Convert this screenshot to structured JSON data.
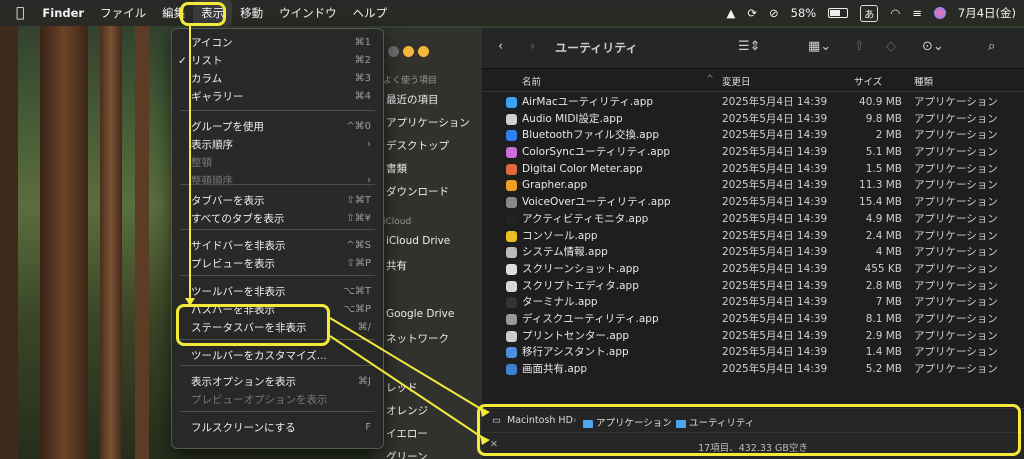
{
  "menubar": {
    "app": "Finder",
    "items": [
      "ファイル",
      "編集",
      "表示",
      "移動",
      "ウインドウ",
      "ヘルプ"
    ],
    "battery": "58%",
    "ime": "あ",
    "date": "7月4日(金)"
  },
  "view_menu": {
    "items": [
      {
        "label": "アイコン",
        "shortcut": "⌘1"
      },
      {
        "label": "リスト",
        "shortcut": "⌘2",
        "checked": "✓"
      },
      {
        "label": "カラム",
        "shortcut": "⌘3"
      },
      {
        "label": "ギャラリー",
        "shortcut": "⌘4"
      },
      {
        "label": "グループを使用",
        "shortcut": "^⌘0"
      },
      {
        "label": "表示順序",
        "shortcut": "›"
      },
      {
        "label": "整頓",
        "shortcut": ""
      },
      {
        "label": "整頓順序",
        "shortcut": "›"
      },
      {
        "label": "タブバーを表示",
        "shortcut": "⇧⌘T"
      },
      {
        "label": "すべてのタブを表示",
        "shortcut": "⇧⌘¥"
      },
      {
        "label": "サイドバーを非表示",
        "shortcut": "^⌘S"
      },
      {
        "label": "プレビューを表示",
        "shortcut": "⇧⌘P"
      },
      {
        "label": "ツールバーを非表示",
        "shortcut": "⌥⌘T"
      },
      {
        "label": "パスバーを非表示",
        "shortcut": "⌥⌘P"
      },
      {
        "label": "ステータスバーを非表示",
        "shortcut": "⌘/"
      },
      {
        "label": "ツールバーをカスタマイズ...",
        "shortcut": ""
      },
      {
        "label": "表示オプションを表示",
        "shortcut": "⌘J"
      },
      {
        "label": "プレビューオプションを表示",
        "shortcut": ""
      },
      {
        "label": "フルスクリーンにする",
        "shortcut": "F"
      }
    ]
  },
  "sidebar": {
    "heads": [
      "よく使う項目",
      "iCloud"
    ],
    "items": [
      "最近の項目",
      "アプリケーション",
      "デスクトップ",
      "書類",
      "ダウンロード",
      "iCloud Drive",
      "共有",
      "Google Drive",
      "ネットワーク",
      "レッド",
      "オレンジ",
      "イエロー",
      "グリーン"
    ]
  },
  "window": {
    "title": "ユーティリティ",
    "columns": {
      "name": "名前",
      "date": "変更日",
      "size": "サイズ",
      "kind": "種類"
    },
    "files": [
      {
        "name": "AirMacユーティリティ.app",
        "date": "2025年5月4日 14:39",
        "size": "40.9 MB",
        "kind": "アプリケーション",
        "color": "#3aa3f5"
      },
      {
        "name": "Audio MIDI設定.app",
        "date": "2025年5月4日 14:39",
        "size": "9.8 MB",
        "kind": "アプリケーション",
        "color": "#cfcfcf"
      },
      {
        "name": "Bluetoothファイル交換.app",
        "date": "2025年5月4日 14:39",
        "size": "2 MB",
        "kind": "アプリケーション",
        "color": "#2f7ff0"
      },
      {
        "name": "ColorSyncユーティリティ.app",
        "date": "2025年5月4日 14:39",
        "size": "5.1 MB",
        "kind": "アプリケーション",
        "color": "#c86fd8"
      },
      {
        "name": "Digital Color Meter.app",
        "date": "2025年5月4日 14:39",
        "size": "1.5 MB",
        "kind": "アプリケーション",
        "color": "#e06a3a"
      },
      {
        "name": "Grapher.app",
        "date": "2025年5月4日 14:39",
        "size": "11.3 MB",
        "kind": "アプリケーション",
        "color": "#f0a020"
      },
      {
        "name": "VoiceOverユーティリティ.app",
        "date": "2025年5月4日 14:39",
        "size": "15.4 MB",
        "kind": "アプリケーション",
        "color": "#888888"
      },
      {
        "name": "アクティビティモニタ.app",
        "date": "2025年5月4日 14:39",
        "size": "4.9 MB",
        "kind": "アプリケーション",
        "color": "#222222"
      },
      {
        "name": "コンソール.app",
        "date": "2025年5月4日 14:39",
        "size": "2.4 MB",
        "kind": "アプリケーション",
        "color": "#e8c020"
      },
      {
        "name": "システム情報.app",
        "date": "2025年5月4日 14:39",
        "size": "4 MB",
        "kind": "アプリケーション",
        "color": "#bbbbbb"
      },
      {
        "name": "スクリーンショット.app",
        "date": "2025年5月4日 14:39",
        "size": "455 KB",
        "kind": "アプリケーション",
        "color": "#dddddd"
      },
      {
        "name": "スクリプトエディタ.app",
        "date": "2025年5月4日 14:39",
        "size": "2.8 MB",
        "kind": "アプリケーション",
        "color": "#d8d8d8"
      },
      {
        "name": "ターミナル.app",
        "date": "2025年5月4日 14:39",
        "size": "7 MB",
        "kind": "アプリケーション",
        "color": "#333333"
      },
      {
        "name": "ディスクユーティリティ.app",
        "date": "2025年5月4日 14:39",
        "size": "8.1 MB",
        "kind": "アプリケーション",
        "color": "#999999"
      },
      {
        "name": "プリントセンター.app",
        "date": "2025年5月4日 14:39",
        "size": "2.9 MB",
        "kind": "アプリケーション",
        "color": "#cccccc"
      },
      {
        "name": "移行アシスタント.app",
        "date": "2025年5月4日 14:39",
        "size": "1.4 MB",
        "kind": "アプリケーション",
        "color": "#4a8fe0"
      },
      {
        "name": "画面共有.app",
        "date": "2025年5月4日 14:39",
        "size": "5.2 MB",
        "kind": "アプリケーション",
        "color": "#3f7fd0"
      }
    ],
    "path": [
      "Macintosh HD",
      "アプリケーション",
      "ユーティリティ"
    ],
    "status": "17項目、432.33 GB空き"
  },
  "icons": [
    "apple-icon",
    "search-icon",
    "back-icon",
    "forward-icon",
    "list-view-icon",
    "grid-icon",
    "share-icon",
    "tag-icon",
    "more-icon"
  ],
  "highlight_color": "#f3ea3a"
}
